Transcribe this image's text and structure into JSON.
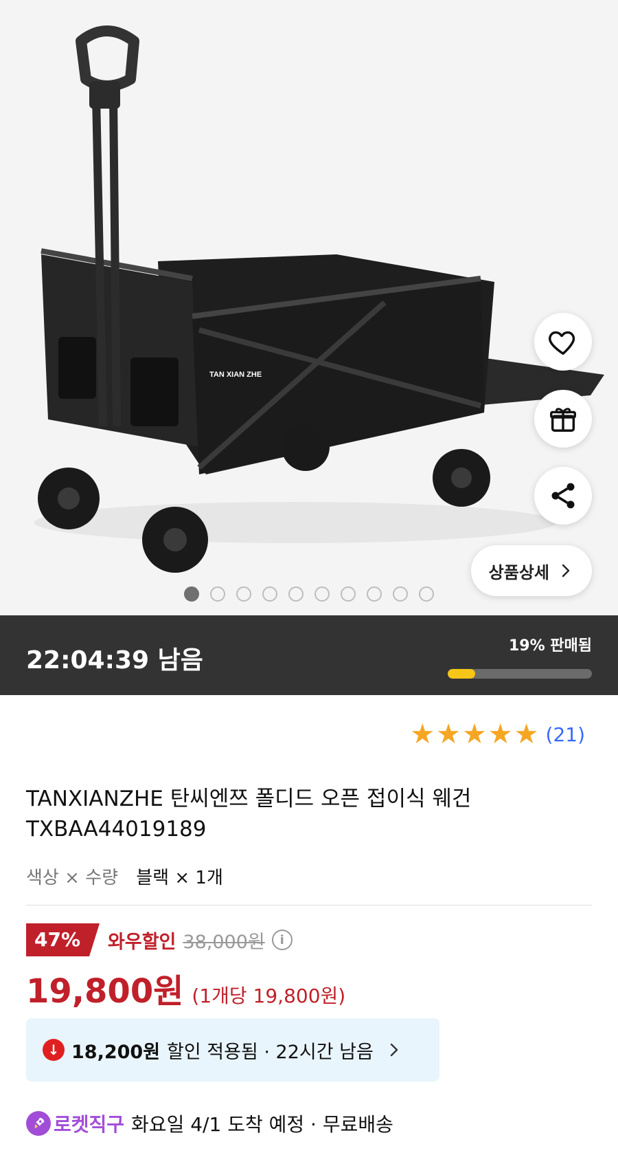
{
  "gallery": {
    "logo_text": "TAN XIAN ZHE",
    "detail_button_label": "상품상세",
    "image_count": 10,
    "active_index": 0
  },
  "deal": {
    "time_left": "22:04:39 남음",
    "sold_text": "19% 판매됨",
    "sold_fraction": 0.19
  },
  "rating": {
    "stars": 5,
    "review_count": "(21)"
  },
  "product": {
    "title": "TANXIANZHE 탄씨엔쯔 폴디드 오픈 접이식 웨건 TXBAA44019189",
    "option_label": "색상 × 수량",
    "option_value": "블랙 × 1개"
  },
  "pricing": {
    "discount_badge": "47%",
    "discount_type": "와우할인",
    "original_price": "38,000원",
    "price": "19,800원",
    "unit_price": "(1개당 19,800원)"
  },
  "coupon": {
    "amount": "18,200원",
    "text": "할인 적용됨 · 22시간 남음"
  },
  "delivery": {
    "label": "로켓직구",
    "text": "화요일 4/1 도착 예정 · 무료배송"
  },
  "colors": {
    "accent_red": "#c0202a",
    "rocket_purple": "#a24dd8",
    "star_gold": "#f5a623",
    "link_blue": "#346aff",
    "progress_yellow": "#f5c518"
  }
}
